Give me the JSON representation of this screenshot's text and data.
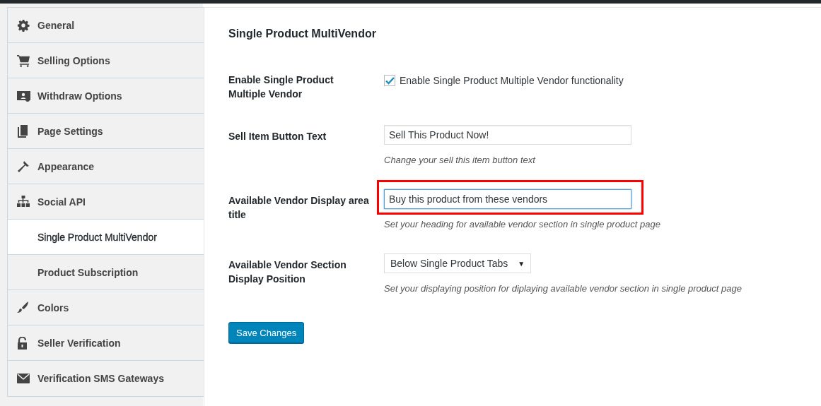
{
  "sidebar": {
    "items": [
      {
        "label": "General",
        "selected": false
      },
      {
        "label": "Selling Options",
        "selected": false
      },
      {
        "label": "Withdraw Options",
        "selected": false
      },
      {
        "label": "Page Settings",
        "selected": false
      },
      {
        "label": "Appearance",
        "selected": false
      },
      {
        "label": "Social API",
        "selected": false
      },
      {
        "label": "Single Product MultiVendor",
        "selected": true
      },
      {
        "label": "Product Subscription",
        "selected": false
      },
      {
        "label": "Colors",
        "selected": false
      },
      {
        "label": "Seller Verification",
        "selected": false
      },
      {
        "label": "Verification SMS Gateways",
        "selected": false
      }
    ]
  },
  "panel": {
    "title": "Single Product MultiVendor",
    "fields": [
      {
        "kind": "checkbox",
        "label": "Enable Single Product Multiple Vendor",
        "option": "Enable Single Product Multiple Vendor functionality",
        "checked": true,
        "highlighted": false
      },
      {
        "kind": "text",
        "label": "Sell Item Button Text",
        "value": "Sell This Product Now!",
        "description": "Change your sell this item button text",
        "highlighted": false
      },
      {
        "kind": "text",
        "label": "Available Vendor Display area title",
        "value": "Buy this product from these vendors",
        "description": "Set your heading for available vendor section in single product page",
        "highlighted": true
      },
      {
        "kind": "select",
        "label": "Available Vendor Section Display Position",
        "value": "Below Single Product Tabs",
        "arrow": "▼",
        "description": "Set your displaying position for diplaying available vendor section in single product page",
        "highlighted": false
      }
    ],
    "save_button": "Save Changes"
  }
}
